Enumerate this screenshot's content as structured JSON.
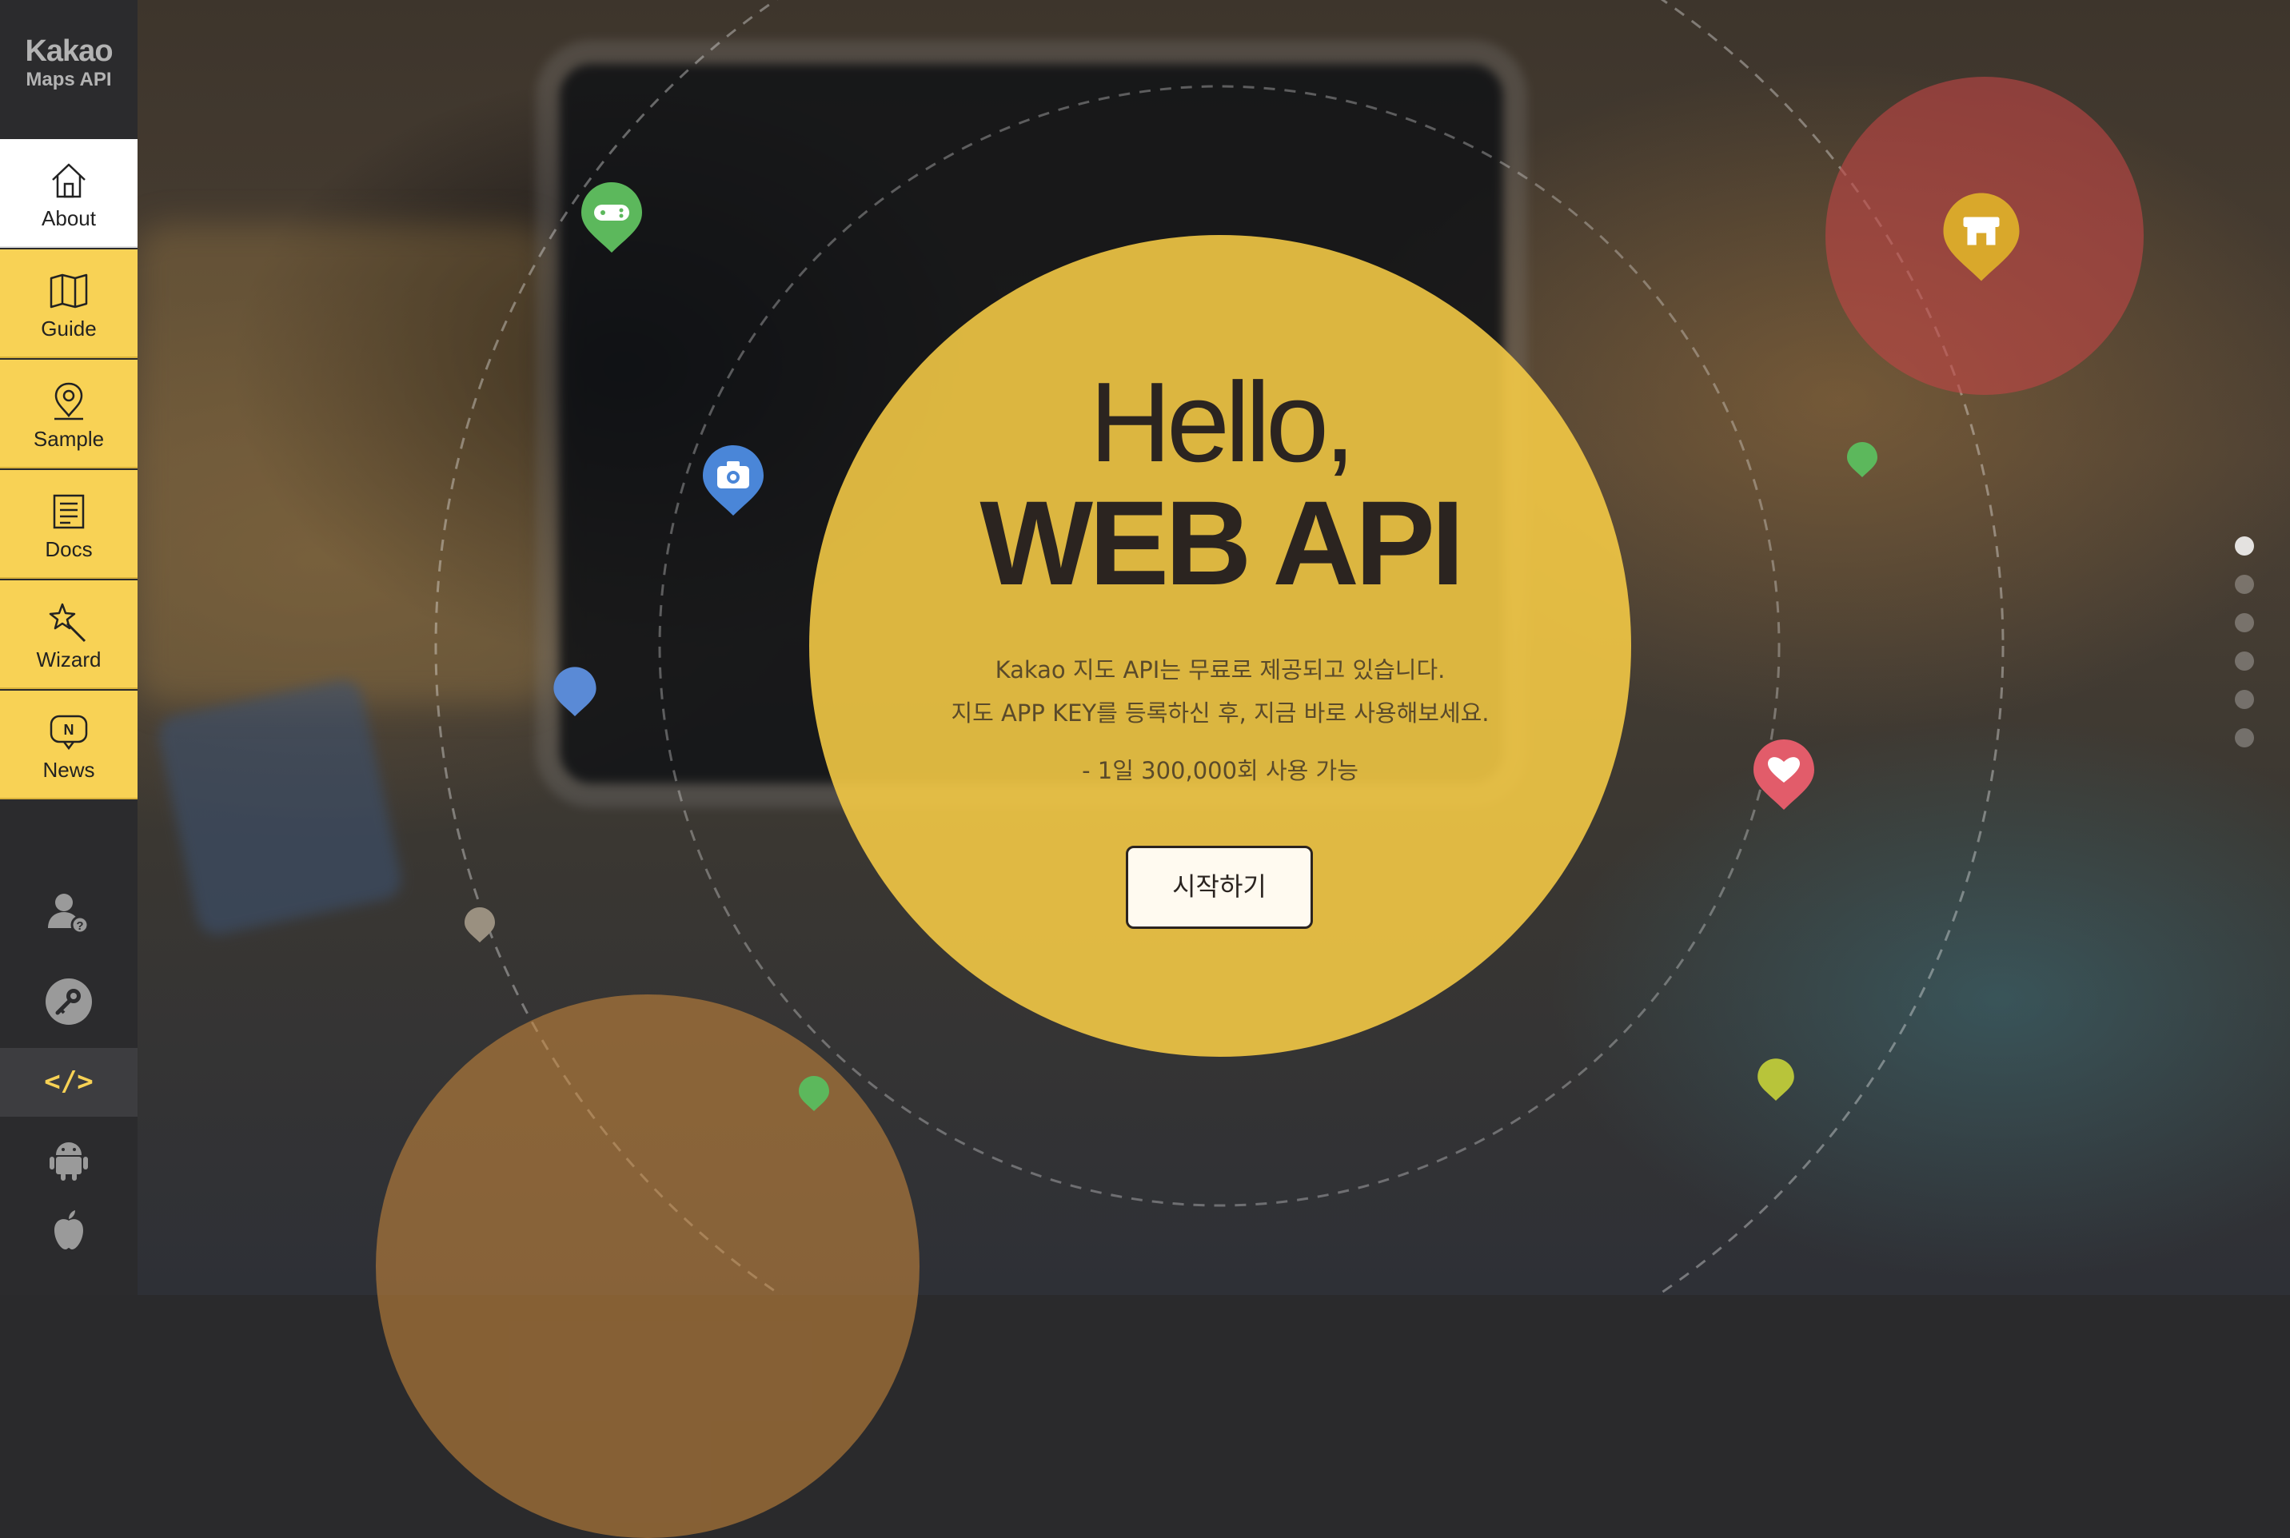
{
  "sidebar": {
    "logo_line1": "Kakao",
    "logo_line2": "Maps API",
    "nav": [
      {
        "label": "About",
        "icon": "home-icon",
        "active": true
      },
      {
        "label": "Guide",
        "icon": "map-book-icon"
      },
      {
        "label": "Sample",
        "icon": "location-pin-icon"
      },
      {
        "label": "Docs",
        "icon": "document-icon"
      },
      {
        "label": "Wizard",
        "icon": "magic-wand-icon"
      },
      {
        "label": "News",
        "icon": "news-bubble-icon"
      }
    ],
    "tools": [
      {
        "icon": "user-help-icon"
      },
      {
        "icon": "key-icon"
      },
      {
        "icon": "code-icon",
        "glyph": "</>",
        "active": true
      },
      {
        "icon": "android-icon"
      },
      {
        "icon": "apple-icon"
      }
    ]
  },
  "hero": {
    "line1": "Hello,",
    "line2": "WEB API",
    "desc1": "Kakao 지도 API는 무료로 제공되고 있습니다.",
    "desc2": "지도 APP KEY를 등록하신 후, 지금 바로 사용해보세요.",
    "limit": "- 1일 300,000회 사용 가능",
    "start_button": "시작하기"
  },
  "pager": {
    "count": 6,
    "active_index": 0
  },
  "colors": {
    "accent_yellow": "#f8d255",
    "sidebar_dark": "#2b2b2d",
    "hero_yellow": "#f7cc46",
    "text_dark": "#2b2420"
  }
}
